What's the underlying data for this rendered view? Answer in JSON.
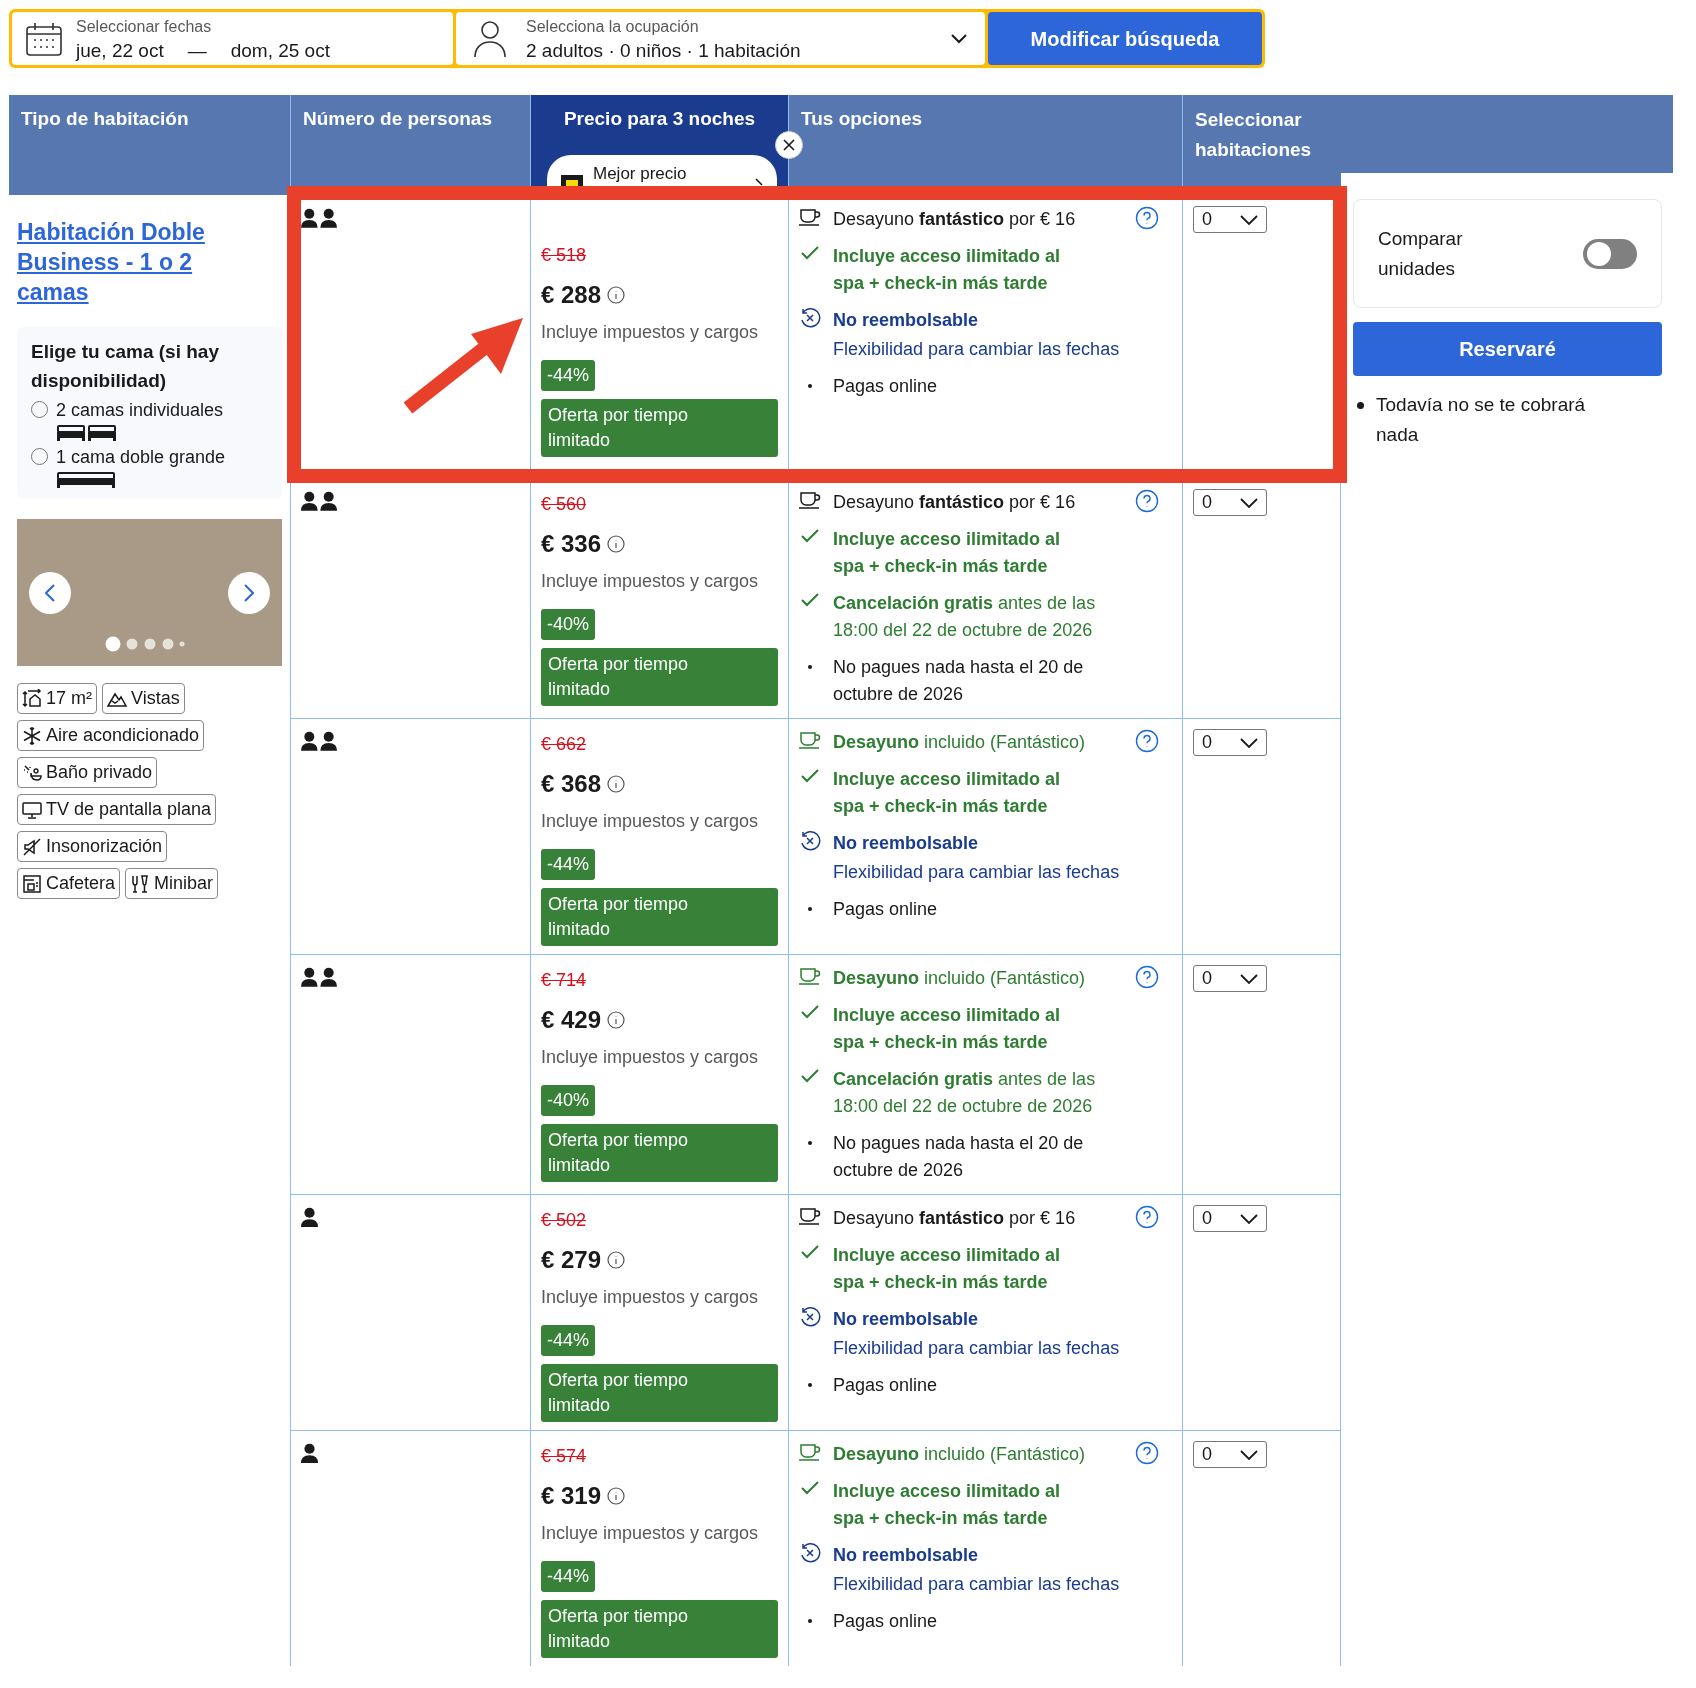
{
  "search_bar": {
    "dates": {
      "label": "Seleccionar fechas",
      "checkin": "jue, 22 oct",
      "separator": "—",
      "checkout": "dom, 25 oct"
    },
    "occupancy": {
      "label": "Selecciona la ocupación",
      "value": "2 adultos · 0 niños · 1 habitación"
    },
    "button": "Modificar búsqueda"
  },
  "table": {
    "columns": [
      "Tipo de habitación",
      "Número de personas",
      "Precio para 3 noches",
      "Tus opciones",
      "Seleccionar habitaciones"
    ],
    "price_popup": {
      "label": "Mejor precio"
    },
    "room": {
      "title": "Habitación Doble Business - 1 o 2 camas",
      "bed_choice": {
        "title": "Elige tu cama (si hay disponibilidad)",
        "options": [
          {
            "label": "2 camas individuales",
            "kind": "twin",
            "selected": false
          },
          {
            "label": "1 cama doble grande",
            "kind": "double",
            "selected": false
          }
        ]
      },
      "facilities": [
        {
          "label": "17 m²",
          "kind": "size"
        },
        {
          "label": "Vistas",
          "kind": "view"
        },
        {
          "label": "Aire acondicionado",
          "kind": "ac"
        },
        {
          "label": "Baño privado",
          "kind": "bath"
        },
        {
          "label": "TV de pantalla plana",
          "kind": "tv"
        },
        {
          "label": "Insonorización",
          "kind": "soundproof"
        },
        {
          "label": "Cafetera",
          "kind": "coffee"
        },
        {
          "label": "Minibar",
          "kind": "minibar"
        }
      ]
    },
    "rows": [
      {
        "kind": "double",
        "old_price": "€ 518",
        "price": "€ 288",
        "taxes": "Incluye impuestos y cargos",
        "discount": "-44%",
        "deal": "Oferta por tiempo limitado",
        "select_value": "0",
        "options": [
          {
            "kind": "breakfast_extra",
            "text": "Desayuno **fantástico** por € 16"
          },
          {
            "kind": "spa",
            "text": "Incluye acceso ilimitado al spa + check-in más tarde"
          },
          {
            "kind": "nonrefundable",
            "text": "No reembolsable",
            "subtext": "Flexibilidad para cambiar las fechas"
          },
          {
            "kind": "bullet",
            "text": "Pagas online"
          }
        ]
      },
      {
        "kind": "double",
        "old_price": "€ 560",
        "price": "€ 336",
        "taxes": "Incluye impuestos y cargos",
        "discount": "-40%",
        "deal": "Oferta por tiempo limitado",
        "select_value": "0",
        "options": [
          {
            "kind": "breakfast_extra",
            "text": "Desayuno **fantástico** por € 16"
          },
          {
            "kind": "spa",
            "text": "Incluye acceso ilimitado al spa + check-in más tarde"
          },
          {
            "kind": "free_cancel",
            "text": "**Cancelación gratis** antes de las 18:00 del 22 de octubre de 2026"
          },
          {
            "kind": "bullet",
            "text": "No pagues nada hasta el 20 de octubre de 2026"
          }
        ]
      },
      {
        "kind": "double",
        "old_price": "€ 662",
        "price": "€ 368",
        "taxes": "Incluye impuestos y cargos",
        "discount": "-44%",
        "deal": "Oferta por tiempo limitado",
        "select_value": "0",
        "options": [
          {
            "kind": "breakfast_included",
            "text": "**Desayuno** incluido (Fantástico)"
          },
          {
            "kind": "spa",
            "text": "Incluye acceso ilimitado al spa + check-in más tarde"
          },
          {
            "kind": "nonrefundable",
            "text": "No reembolsable",
            "subtext": "Flexibilidad para cambiar las fechas"
          },
          {
            "kind": "bullet",
            "text": "Pagas online"
          }
        ]
      },
      {
        "kind": "double",
        "old_price": "€ 714",
        "price": "€ 429",
        "taxes": "Incluye impuestos y cargos",
        "discount": "-40%",
        "deal": "Oferta por tiempo limitado",
        "select_value": "0",
        "options": [
          {
            "kind": "breakfast_included",
            "text": "**Desayuno** incluido (Fantástico)"
          },
          {
            "kind": "spa",
            "text": "Incluye acceso ilimitado al spa + check-in más tarde"
          },
          {
            "kind": "free_cancel",
            "text": "**Cancelación gratis** antes de las 18:00 del 22 de octubre de 2026"
          },
          {
            "kind": "bullet",
            "text": "No pagues nada hasta el 20 de octubre de 2026"
          }
        ]
      },
      {
        "kind": "single",
        "old_price": "€ 502",
        "price": "€ 279",
        "taxes": "Incluye impuestos y cargos",
        "discount": "-44%",
        "deal": "Oferta por tiempo limitado",
        "select_value": "0",
        "options": [
          {
            "kind": "breakfast_extra",
            "text": "Desayuno **fantástico** por € 16"
          },
          {
            "kind": "spa",
            "text": "Incluye acceso ilimitado al spa + check-in más tarde"
          },
          {
            "kind": "nonrefundable",
            "text": "No reembolsable",
            "subtext": "Flexibilidad para cambiar las fechas"
          },
          {
            "kind": "bullet",
            "text": "Pagas online"
          }
        ]
      },
      {
        "kind": "single",
        "old_price": "€ 574",
        "price": "€ 319",
        "taxes": "Incluye impuestos y cargos",
        "discount": "-44%",
        "deal": "Oferta por tiempo limitado",
        "select_value": "0",
        "options": [
          {
            "kind": "breakfast_included",
            "text": "**Desayuno** incluido (Fantástico)"
          },
          {
            "kind": "spa",
            "text": "Incluye acceso ilimitado al spa + check-in más tarde"
          },
          {
            "kind": "nonrefundable",
            "text": "No reembolsable",
            "subtext": "Flexibilidad para cambiar las fechas"
          },
          {
            "kind": "bullet",
            "text": "Pagas online"
          }
        ]
      }
    ]
  },
  "sidebar": {
    "compare": {
      "label": "Comparar unidades",
      "on": false
    },
    "button": "Reservaré",
    "notes": [
      "Todavía no se te cobrará nada"
    ]
  }
}
